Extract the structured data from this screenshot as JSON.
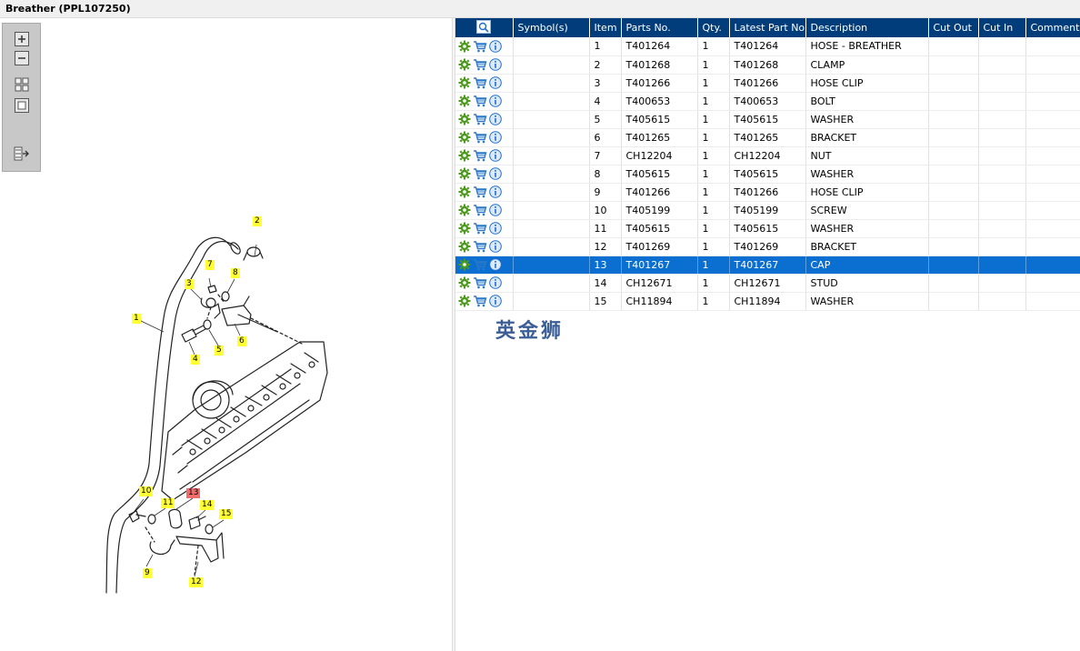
{
  "title": "Breather (PPL107250)",
  "toolbar": {
    "buttons": [
      {
        "name": "zoom-in-icon"
      },
      {
        "name": "zoom-out-icon"
      },
      {
        "name": "fit-all-icon"
      },
      {
        "name": "fit-window-icon"
      },
      {
        "name": "toggle-list-icon"
      }
    ]
  },
  "callouts": [
    "1",
    "2",
    "3",
    "4",
    "5",
    "6",
    "7",
    "8",
    "9",
    "10",
    "11",
    "12",
    "13",
    "14",
    "15"
  ],
  "selected_item": "13",
  "table": {
    "headers": [
      "",
      "Symbol(s)",
      "Item",
      "Parts No.",
      "Qty.",
      "Latest Part No.",
      "Description",
      "Cut Out",
      "Cut In",
      "Comment"
    ],
    "rows": [
      {
        "item": "1",
        "part": "T401264",
        "qty": "1",
        "latest": "T401264",
        "desc": "HOSE - BREATHER"
      },
      {
        "item": "2",
        "part": "T401268",
        "qty": "1",
        "latest": "T401268",
        "desc": "CLAMP"
      },
      {
        "item": "3",
        "part": "T401266",
        "qty": "1",
        "latest": "T401266",
        "desc": "HOSE CLIP"
      },
      {
        "item": "4",
        "part": "T400653",
        "qty": "1",
        "latest": "T400653",
        "desc": "BOLT"
      },
      {
        "item": "5",
        "part": "T405615",
        "qty": "1",
        "latest": "T405615",
        "desc": "WASHER"
      },
      {
        "item": "6",
        "part": "T401265",
        "qty": "1",
        "latest": "T401265",
        "desc": "BRACKET"
      },
      {
        "item": "7",
        "part": "CH12204",
        "qty": "1",
        "latest": "CH12204",
        "desc": "NUT"
      },
      {
        "item": "8",
        "part": "T405615",
        "qty": "1",
        "latest": "T405615",
        "desc": "WASHER"
      },
      {
        "item": "9",
        "part": "T401266",
        "qty": "1",
        "latest": "T401266",
        "desc": "HOSE CLIP"
      },
      {
        "item": "10",
        "part": "T405199",
        "qty": "1",
        "latest": "T405199",
        "desc": "SCREW"
      },
      {
        "item": "11",
        "part": "T405615",
        "qty": "1",
        "latest": "T405615",
        "desc": "WASHER"
      },
      {
        "item": "12",
        "part": "T401269",
        "qty": "1",
        "latest": "T401269",
        "desc": "BRACKET"
      },
      {
        "item": "13",
        "part": "T401267",
        "qty": "1",
        "latest": "T401267",
        "desc": "CAP"
      },
      {
        "item": "14",
        "part": "CH12671",
        "qty": "1",
        "latest": "CH12671",
        "desc": "STUD"
      },
      {
        "item": "15",
        "part": "CH11894",
        "qty": "1",
        "latest": "CH11894",
        "desc": "WASHER"
      }
    ]
  },
  "watermark": "英金狮",
  "colors": {
    "header_bg": "#003d7a",
    "selected_row": "#0a6fd1",
    "callout": "#ffff33",
    "callout_selected": "#f06b6b",
    "gear": "#4c9a1e",
    "cart": "#2c78c8",
    "info": "#1f6fd0"
  }
}
